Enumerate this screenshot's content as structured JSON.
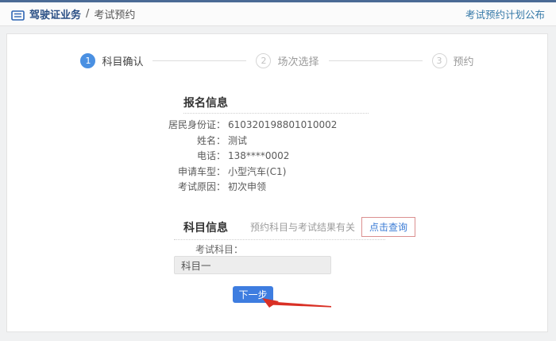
{
  "header": {
    "breadcrumb_primary": "驾驶证业务",
    "breadcrumb_separator": "/",
    "breadcrumb_current": "考试预约",
    "plan_link": "考试预约计划公布"
  },
  "steps": [
    {
      "num": "1",
      "label": "科目确认",
      "state": "active"
    },
    {
      "num": "2",
      "label": "场次选择",
      "state": "inactive"
    },
    {
      "num": "3",
      "label": "预约",
      "state": "inactive"
    }
  ],
  "registration": {
    "title": "报名信息",
    "fields": [
      {
        "label": "居民身份证：",
        "value": "610320198801010002"
      },
      {
        "label": "姓名：",
        "value": "测试"
      },
      {
        "label": "电话：",
        "value": "138****0002"
      },
      {
        "label": "申请车型：",
        "value": "小型汽车(C1)"
      },
      {
        "label": "考试原因：",
        "value": "初次申领"
      }
    ]
  },
  "subject": {
    "title": "科目信息",
    "note": "预约科目与考试结果有关",
    "query_link": "点击查询",
    "exam_label": "考试科目：",
    "exam_value": "科目一"
  },
  "next_button_label": "下一步",
  "colors": {
    "accent_blue": "#4a90e2",
    "button_blue": "#3e7de0",
    "link_blue": "#3a7bd5",
    "plan_link_blue": "#3579a8",
    "topbar_border": "#4a6a95",
    "annotation_red": "#d93025",
    "query_box_border": "#db9090"
  }
}
